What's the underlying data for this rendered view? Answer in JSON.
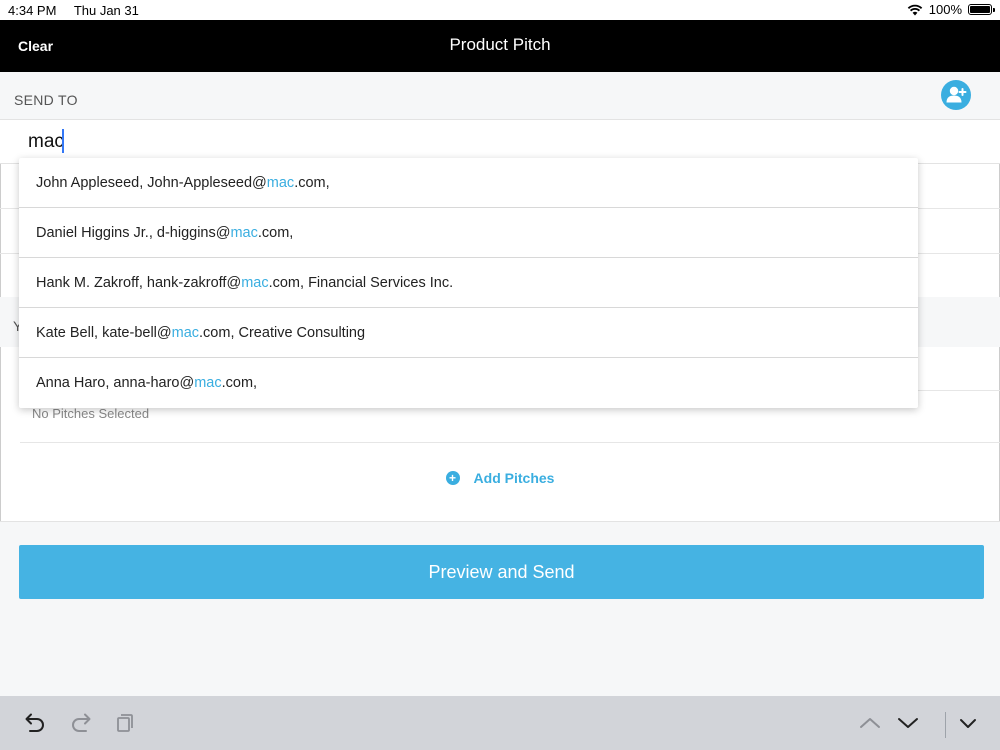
{
  "status_bar": {
    "time": "4:34 PM",
    "date": "Thu Jan 31",
    "battery": "100%"
  },
  "nav": {
    "clear_label": "Clear",
    "title": "Product Pitch"
  },
  "send_to": {
    "label": "SEND TO",
    "search_value": "mac"
  },
  "suggestions": [
    {
      "pre": "John Appleseed, John-Appleseed@",
      "match": "mac",
      "post": ".com,"
    },
    {
      "pre": "Daniel Higgins Jr., d-higgins@",
      "match": "mac",
      "post": ".com,"
    },
    {
      "pre": "Hank M. Zakroff, hank-zakroff@",
      "match": "mac",
      "post": ".com, Financial Services Inc."
    },
    {
      "pre": "Kate Bell, kate-bell@",
      "match": "mac",
      "post": ".com, Creative Consulting"
    },
    {
      "pre": "Anna Haro, anna-haro@",
      "match": "mac",
      "post": ".com,"
    }
  ],
  "background": {
    "section_letter": "Y",
    "no_pitches": "No Pitches Selected",
    "add_pitches": "Add Pitches"
  },
  "preview_button": "Preview and Send",
  "colors": {
    "accent": "#3aaee0",
    "button": "#45b3e3",
    "nav_bg": "#000000"
  },
  "keyboard_bar": {
    "icons": [
      "undo-icon",
      "redo-icon",
      "paste-icon",
      "chevron-up-icon",
      "chevron-down-icon",
      "hide-keyboard-icon"
    ]
  }
}
